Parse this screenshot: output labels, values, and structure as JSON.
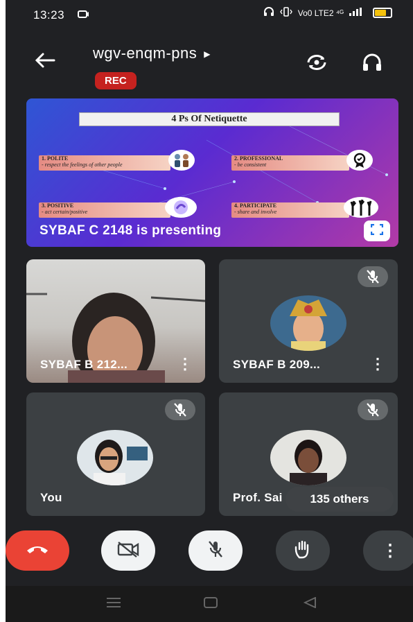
{
  "status": {
    "time": "13:23",
    "net": "Vo0 LTE2 ⁴ᴳ"
  },
  "header": {
    "meeting_code": "wgv-enqm-pns",
    "rec": "REC"
  },
  "presentation": {
    "slide_title": "4 Ps Of Netiquette",
    "items": [
      {
        "head": "1. POLITE",
        "sub": "- respect the feelings of other people"
      },
      {
        "head": "2. PROFESSIONAL",
        "sub": "- be consistent"
      },
      {
        "head": "3. POSITIVE",
        "sub": "- act certain/positive"
      },
      {
        "head": "4. PARTICIPATE",
        "sub": "- share and involve"
      }
    ],
    "presenter_label": "SYBAF C 2148 is presenting"
  },
  "tiles": [
    {
      "name": "SYBAF B 212..."
    },
    {
      "name": "SYBAF B 209..."
    },
    {
      "name": "You"
    },
    {
      "name": "Prof. Sai"
    }
  ],
  "others": "135 others",
  "colors": {
    "end_call": "#ea4335",
    "rec": "#c5221f",
    "tile": "#3c4043",
    "background": "#202124"
  }
}
